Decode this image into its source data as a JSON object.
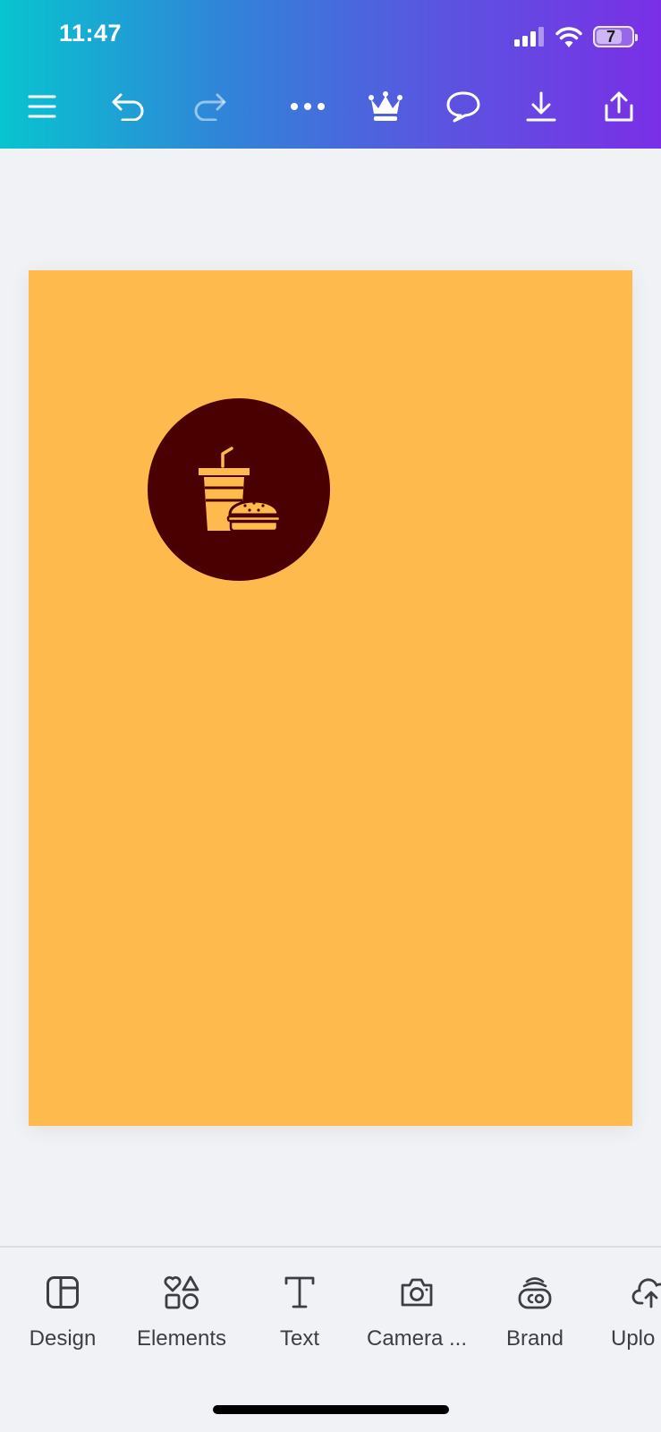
{
  "status_bar": {
    "time": "11:47",
    "battery_level": "7"
  },
  "toolbar": {
    "icons": [
      "menu-icon",
      "undo-icon",
      "redo-icon",
      "more-icon",
      "crown-icon",
      "comment-icon",
      "download-icon",
      "share-icon"
    ]
  },
  "canvas": {
    "page_color": "#ffba4d",
    "badge_color": "#4a0000",
    "badge_icon": "fast-food-icon"
  },
  "bottom_tabs": [
    {
      "label": "Design",
      "icon": "design-layout-icon"
    },
    {
      "label": "Elements",
      "icon": "elements-shapes-icon"
    },
    {
      "label": "Text",
      "icon": "text-icon"
    },
    {
      "label": "Camera ...",
      "icon": "camera-icon"
    },
    {
      "label": "Brand",
      "icon": "brand-icon"
    },
    {
      "label": "Uplo",
      "icon": "upload-cloud-icon"
    }
  ],
  "colors": {
    "header_gradient_start": "#08c4cf",
    "header_gradient_end": "#7a2fe6",
    "background": "#f1f2f6"
  }
}
